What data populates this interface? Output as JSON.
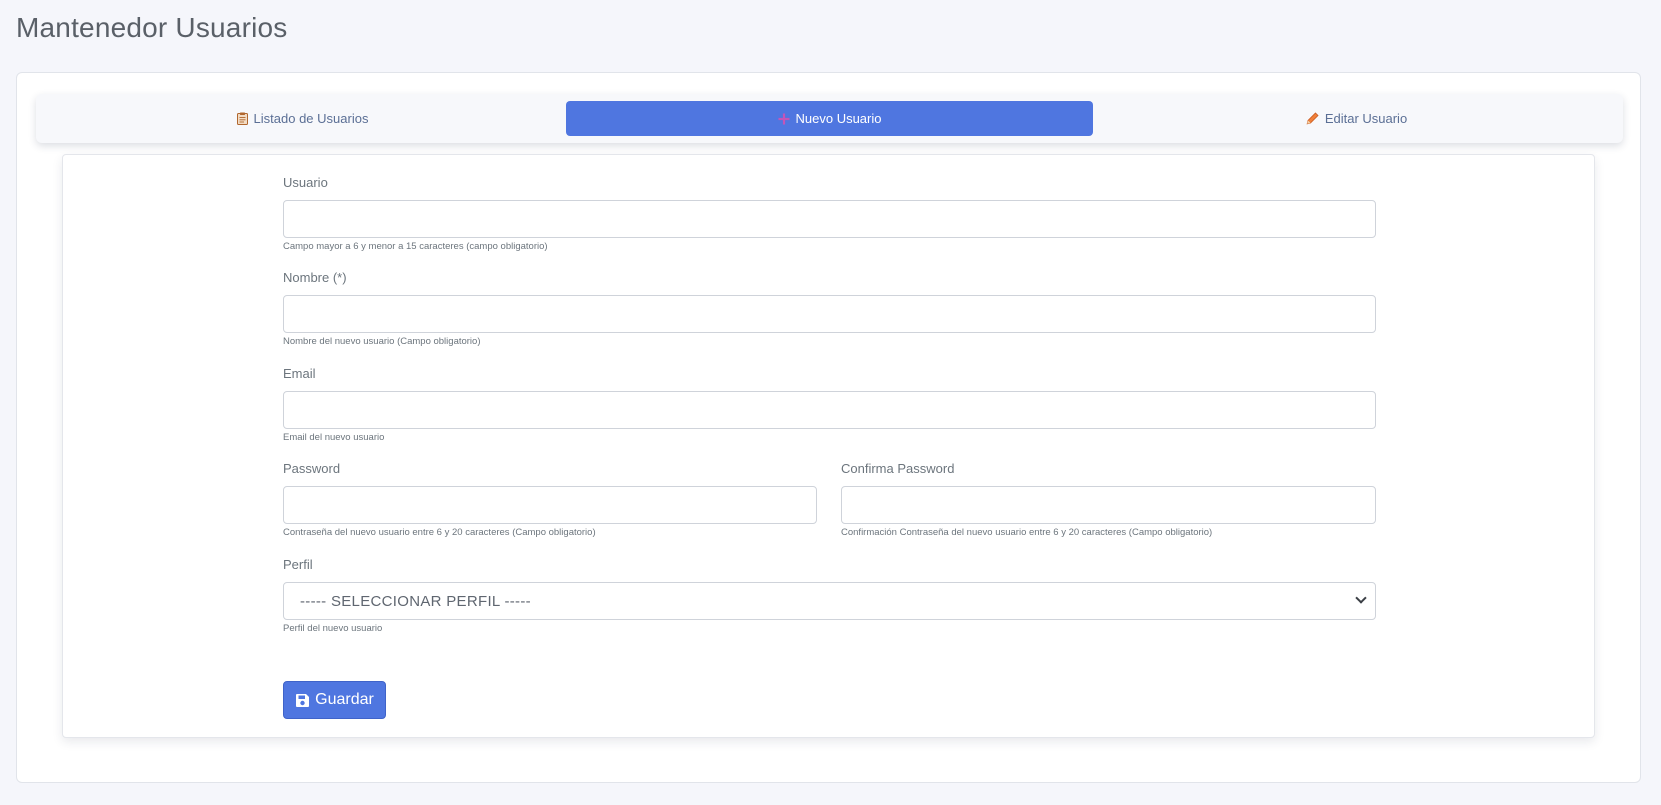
{
  "page": {
    "title": "Mantenedor Usuarios"
  },
  "tabs": [
    {
      "label": "Listado de Usuarios",
      "icon": "clipboard-icon",
      "active": false
    },
    {
      "label": "Nuevo Usuario",
      "icon": "plus-icon",
      "active": true
    },
    {
      "label": "Editar Usuario",
      "icon": "pencil-icon",
      "active": false
    }
  ],
  "form": {
    "usuario": {
      "label": "Usuario",
      "value": "",
      "help": "Campo mayor a 6 y menor a 15 caracteres (campo obligatorio)"
    },
    "nombre": {
      "label": "Nombre (*)",
      "value": "",
      "help": "Nombre del nuevo usuario (Campo obligatorio)"
    },
    "email": {
      "label": "Email",
      "value": "",
      "help": "Email del nuevo usuario"
    },
    "password": {
      "label": "Password",
      "value": "",
      "help": "Contraseña del nuevo usuario entre 6 y 20 caracteres (Campo obligatorio)"
    },
    "confirma": {
      "label": "Confirma Password",
      "value": "",
      "help": "Confirmación Contraseña del nuevo usuario entre 6 y 20 caracteres (Campo obligatorio)"
    },
    "perfil": {
      "label": "Perfil",
      "selected": "----- SELECCIONAR PERFIL -----",
      "help": "Perfil del nuevo usuario"
    },
    "save_label": "Guardar"
  },
  "colors": {
    "primary": "#4f76e0",
    "background": "#f5f6fb"
  }
}
